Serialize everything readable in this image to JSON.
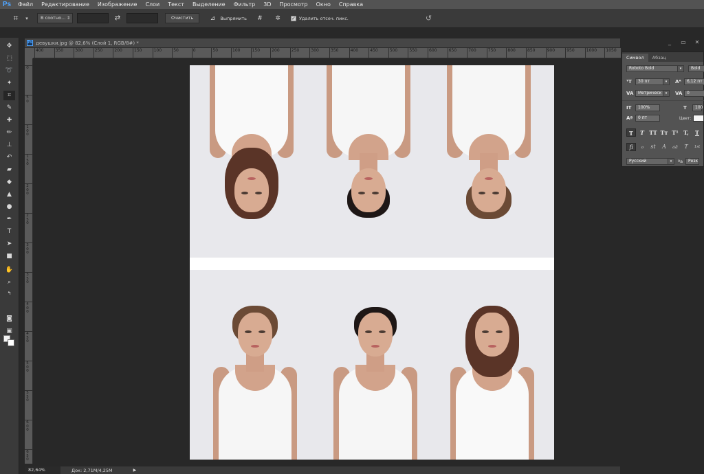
{
  "app": {
    "logo": "Ps",
    "menu": [
      "Файл",
      "Редактирование",
      "Изображение",
      "Слои",
      "Текст",
      "Выделение",
      "Фильтр",
      "3D",
      "Просмотр",
      "Окно",
      "Справка"
    ]
  },
  "options_bar": {
    "ratio_select": "В соотно...",
    "clear_label": "Очистить",
    "straighten_label": "Выпрямить",
    "delete_cropped_label": "Удалить отсеч. пикс.",
    "delete_cropped_checked": true
  },
  "document": {
    "tab_title": "девушки.jpg @ 82,6% (Слой 1, RGB/8#) *",
    "ps_badge": "Ps"
  },
  "rulers": {
    "horizontal": [
      "400",
      "350",
      "300",
      "250",
      "200",
      "150",
      "100",
      "50",
      "0",
      "50",
      "100",
      "150",
      "200",
      "250",
      "300",
      "350",
      "400",
      "450",
      "500",
      "550",
      "600",
      "650",
      "700",
      "750",
      "800",
      "850",
      "900",
      "950",
      "1000",
      "1050"
    ],
    "vertical": [
      "0",
      "50",
      "100",
      "150",
      "200",
      "250",
      "300",
      "350",
      "400",
      "450",
      "500",
      "550",
      "600",
      "650"
    ]
  },
  "status": {
    "zoom": "82,64%",
    "doc_info": "Док: 2,71M/4,25M",
    "arrow": "▶"
  },
  "toolbar": {
    "tools": [
      "move-tool",
      "marquee-tool",
      "lasso-tool",
      "magic-wand-tool",
      "crop-tool",
      "eyedropper-tool",
      "healing-brush-tool",
      "brush-tool",
      "clone-stamp-tool",
      "history-brush-tool",
      "eraser-tool",
      "paint-bucket-tool",
      "blur-tool",
      "dodge-tool",
      "pen-tool",
      "type-tool",
      "path-selection-tool",
      "rectangle-tool",
      "hand-tool",
      "zoom-tool"
    ],
    "foreground_color": "#f4f4f4",
    "background_color": "#ffffff"
  },
  "character_panel": {
    "tabs": [
      "Символ",
      "Абзац"
    ],
    "active_tab": "Символ",
    "font_family": "Roboto Bold",
    "font_style": "Bold",
    "size": "30 пт",
    "leading": "6,12 пт",
    "kerning": "Метрическ",
    "tracking": "0",
    "vertical_scale": "100%",
    "horizontal_scale": "100",
    "baseline_shift": "0 пт",
    "color_label": "Цвет:",
    "style_buttons": [
      "T",
      "T",
      "TT",
      "Tт",
      "T¹",
      "T,",
      "T"
    ],
    "opentype_buttons": [
      "fi",
      "ℴ",
      "st",
      "A",
      "aā",
      "T",
      "1st"
    ],
    "language": "Русский",
    "aa_label": "ªa",
    "antialias": "Резк"
  },
  "colors": {
    "app_bg": "#282828",
    "menubar": "#535353",
    "accent": "#4fa5ff",
    "photo_bg": "#e8e8ec"
  }
}
